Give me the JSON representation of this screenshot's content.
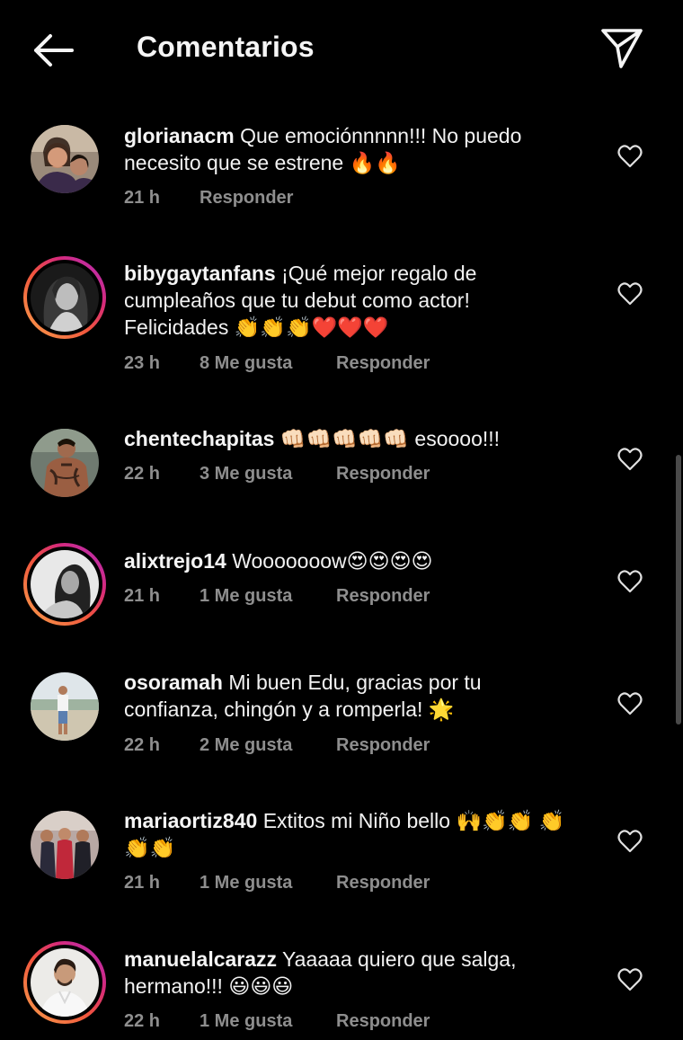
{
  "header": {
    "title": "Comentarios",
    "back_icon": "arrow-left-icon",
    "share_icon": "paper-plane-icon"
  },
  "comments": [
    {
      "username": "glorianacm",
      "text": "Que emociónnnnn!!! No puedo necesito que se estrene 🔥🔥",
      "time": "21 h",
      "likes": "",
      "reply": "Responder",
      "story_ring": false
    },
    {
      "username": "bibygaytanfans",
      "text": "¡Qué mejor regalo de cumpleaños que tu debut como actor! Felicidades 👏👏👏❤️❤️❤️",
      "time": "23 h",
      "likes": "8 Me gusta",
      "reply": "Responder",
      "story_ring": true
    },
    {
      "username": "chentechapitas",
      "text": "👊🏻👊🏻👊🏻👊🏻👊🏻 esoooo!!!",
      "time": "22 h",
      "likes": "3 Me gusta",
      "reply": "Responder",
      "story_ring": false
    },
    {
      "username": "alixtrejo14",
      "text": "Wooooooow😍😍😍😍",
      "time": "21 h",
      "likes": "1 Me gusta",
      "reply": "Responder",
      "story_ring": true
    },
    {
      "username": "osoramah",
      "text": "Mi buen Edu, gracias por tu confianza, chingón y a romperla! 🌟",
      "time": "22 h",
      "likes": "2 Me gusta",
      "reply": "Responder",
      "story_ring": false
    },
    {
      "username": "mariaortiz840",
      "text": "Extitos mi Niño bello 🙌👏👏 👏👏👏",
      "time": "21 h",
      "likes": "1 Me gusta",
      "reply": "Responder",
      "story_ring": false
    },
    {
      "username": "manuelalcarazz",
      "text": "Yaaaaa quiero que salga, hermano!!! 😃😃😃",
      "time": "22 h",
      "likes": "1 Me gusta",
      "reply": "Responder",
      "story_ring": true
    }
  ],
  "colors": {
    "background": "#000000",
    "text": "#f5f5f5",
    "meta": "#8e8e8e",
    "ring_start": "#f9a24b",
    "ring_end": "#b02fc2"
  }
}
